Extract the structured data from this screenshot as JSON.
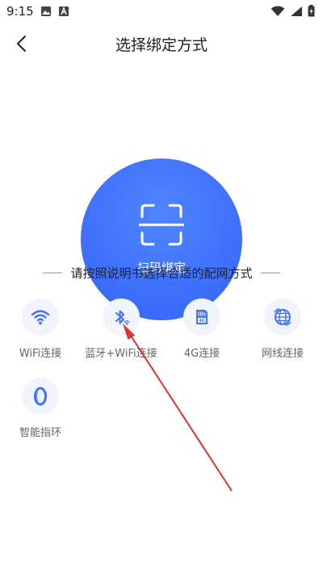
{
  "status_bar": {
    "time": "9:15"
  },
  "header": {
    "title": "选择绑定方式"
  },
  "scan": {
    "label": "扫码绑定"
  },
  "divider": {
    "text": "请按照说明书选择合适的配网方式"
  },
  "options": [
    {
      "label": "WiFi连接",
      "icon": "wifi-icon"
    },
    {
      "label": "蓝牙+WiFi连接",
      "icon": "bluetooth-wifi-icon"
    },
    {
      "label": "4G连接",
      "icon": "sim-4g-icon"
    },
    {
      "label": "网线连接",
      "icon": "ethernet-globe-icon"
    },
    {
      "label": "智能指环",
      "icon": "ring-icon"
    }
  ],
  "colors": {
    "accent": "#3f72fb",
    "icon_bg": "#f1f4fb",
    "annotation_arrow": "#e0322f"
  }
}
